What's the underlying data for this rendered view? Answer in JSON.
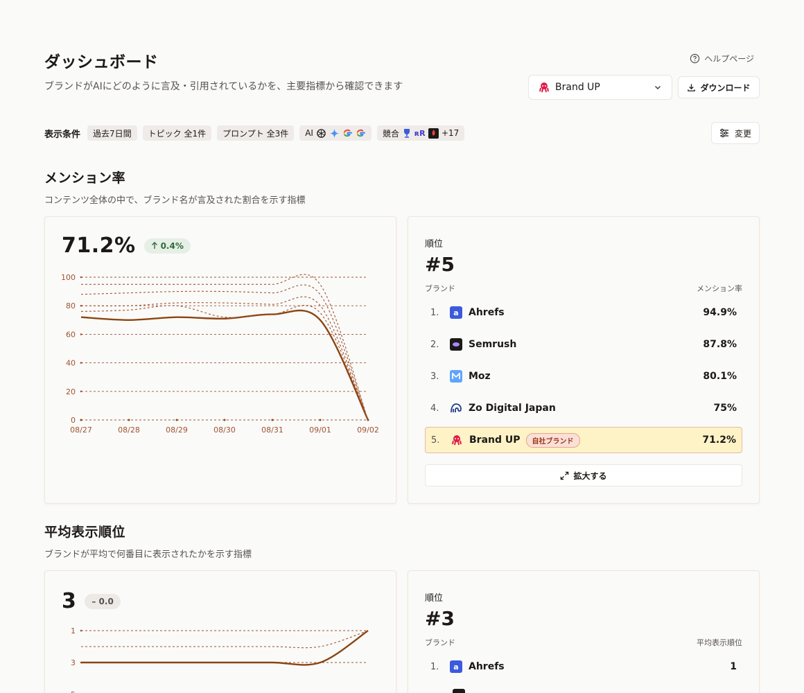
{
  "header": {
    "title": "ダッシュボード",
    "subtitle": "ブランドがAIにどのように言及・引用されているかを、主要指標から確認できます",
    "help_label": "ヘルプページ",
    "brand_selected": "Brand UP",
    "download_label": "ダウンロード"
  },
  "filters": {
    "label": "表示条件",
    "period": "過去7日間",
    "topic": "トピック 全1件",
    "prompt": "プロンプト 全3件",
    "ai_label": "AI",
    "competitor_label": "競合",
    "competitor_more": "+17",
    "change_label": "変更"
  },
  "mention": {
    "title": "メンション率",
    "desc": "コンテンツ全体の中で、ブランド名が言及された割合を示す指標",
    "value": "71.2%",
    "delta": "0.4%",
    "rank_label": "順位",
    "rank": "#5",
    "col_brand": "ブランド",
    "col_metric": "メンション率",
    "own_badge": "自社ブランド",
    "expand_label": "拡大する",
    "rows": [
      {
        "n": "1.",
        "name": "Ahrefs",
        "val": "94.9%"
      },
      {
        "n": "2.",
        "name": "Semrush",
        "val": "87.8%"
      },
      {
        "n": "3.",
        "name": "Moz",
        "val": "80.1%"
      },
      {
        "n": "4.",
        "name": "Zo Digital Japan",
        "val": "75%"
      },
      {
        "n": "5.",
        "name": "Brand UP",
        "val": "71.2%"
      }
    ]
  },
  "avg": {
    "title": "平均表示順位",
    "desc": "ブランドが平均で何番目に表示されたかを示す指標",
    "value": "3",
    "delta": "– 0.0",
    "rank_label": "順位",
    "rank": "#3",
    "col_brand": "ブランド",
    "col_metric": "平均表示順位",
    "rows": [
      {
        "n": "1.",
        "name": "Ahrefs",
        "val": "1"
      }
    ]
  },
  "colors": {
    "line_main": "#8b4513",
    "dashed": "#a0522d",
    "accent": "#b45309"
  },
  "chart_data": [
    {
      "type": "line",
      "x": [
        "08/27",
        "08/28",
        "08/29",
        "08/30",
        "08/31",
        "09/01",
        "09/02"
      ],
      "ylim": [
        0,
        100
      ],
      "yticks": [
        0,
        20,
        40,
        60,
        80,
        100
      ],
      "series": [
        {
          "values": [
            72,
            70,
            72,
            71,
            74,
            70,
            0
          ]
        },
        {
          "values": [
            95,
            95,
            95,
            95,
            95,
            94.9,
            0
          ]
        },
        {
          "values": [
            88,
            89,
            90,
            90,
            89,
            87.8,
            0
          ]
        },
        {
          "values": [
            80,
            80,
            82,
            82,
            81,
            80.1,
            0
          ]
        },
        {
          "values": [
            76,
            77,
            80,
            72,
            74,
            75,
            0
          ]
        }
      ]
    },
    {
      "type": "line",
      "x": [
        "08/27",
        "08/28",
        "08/29",
        "08/30",
        "08/31",
        "09/01",
        "09/02"
      ],
      "ylim": [
        1,
        5
      ],
      "yticks": [
        1,
        3,
        5
      ],
      "series": [
        {
          "values": [
            3,
            3,
            3,
            3,
            3,
            3,
            1
          ]
        },
        {
          "values": [
            2,
            2,
            2,
            2,
            2,
            2,
            1
          ]
        },
        {
          "values": [
            1,
            1,
            1,
            1,
            1,
            1,
            1
          ]
        }
      ]
    }
  ]
}
